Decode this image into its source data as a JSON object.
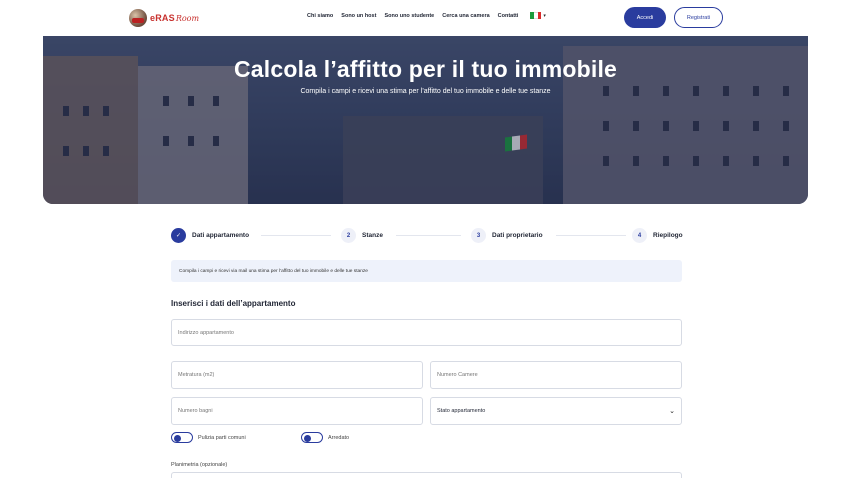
{
  "nav": {
    "logo_text": "eRAS",
    "logo_script": "Room",
    "links": [
      "Chi siamo",
      "Sono un host",
      "Sono uno studente",
      "Cerca una camera",
      "Contatti"
    ],
    "language": "IT",
    "login": "Accedi",
    "register": "Registrati"
  },
  "hero": {
    "title": "Calcola l’affitto per il tuo immobile",
    "subtitle": "Compila i campi e ricevi una stima per l’affitto del tuo immobile e delle tue stanze"
  },
  "stepper": {
    "steps": [
      {
        "number": "1",
        "label": "Dati appartamento",
        "status": "done"
      },
      {
        "number": "2",
        "label": "Stanze",
        "status": "todo"
      },
      {
        "number": "3",
        "label": "Dati proprietario",
        "status": "todo"
      },
      {
        "number": "4",
        "label": "Riepilogo",
        "status": "todo"
      }
    ]
  },
  "info_text": "Compila i campi e ricevi via mail una stima per l’affitto del tuo immobile e delle tue stanze",
  "form": {
    "section_title": "Inserisci i dati dell’appartamento",
    "address_placeholder": "Indirizzo appartamento",
    "size_placeholder": "Metratura (m2)",
    "rooms_placeholder": "Numero Camere",
    "baths_placeholder": "Numero bagni",
    "state_selected": "Stato appartamento",
    "toggle_cleaning": "Pulizia parti comuni",
    "toggle_furnished": "Arredato",
    "plan_label": "Planimetria (opzionale)"
  },
  "colors": {
    "primary": "#2a3c9e",
    "brand_red": "#c8312e"
  }
}
